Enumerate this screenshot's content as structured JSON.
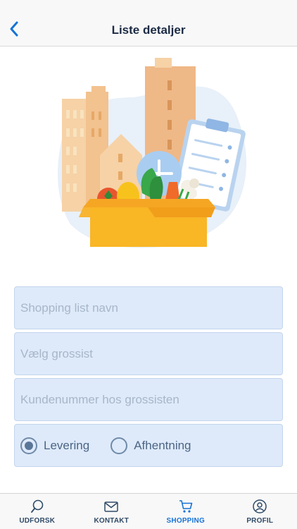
{
  "header": {
    "title": "Liste detaljer",
    "back_icon": "chevron-left-icon"
  },
  "colors": {
    "accent": "#1673d6",
    "field_bg": "#deeafa",
    "header_title": "#1c2b45"
  },
  "form": {
    "list_name_placeholder": "Shopping list navn",
    "wholesaler_placeholder": "Vælg grossist",
    "customer_number_placeholder": "Kundenummer hos grossisten",
    "delivery_options": [
      {
        "label": "Levering",
        "selected": true
      },
      {
        "label": "Afhentning",
        "selected": false
      }
    ]
  },
  "tabbar": {
    "items": [
      {
        "label": "UDFORSK",
        "icon": "search-icon",
        "active": false
      },
      {
        "label": "KONTAKT",
        "icon": "mail-icon",
        "active": false
      },
      {
        "label": "SHOPPING",
        "icon": "cart-icon",
        "active": true
      },
      {
        "label": "PROFIL",
        "icon": "profile-icon",
        "active": false
      }
    ]
  }
}
